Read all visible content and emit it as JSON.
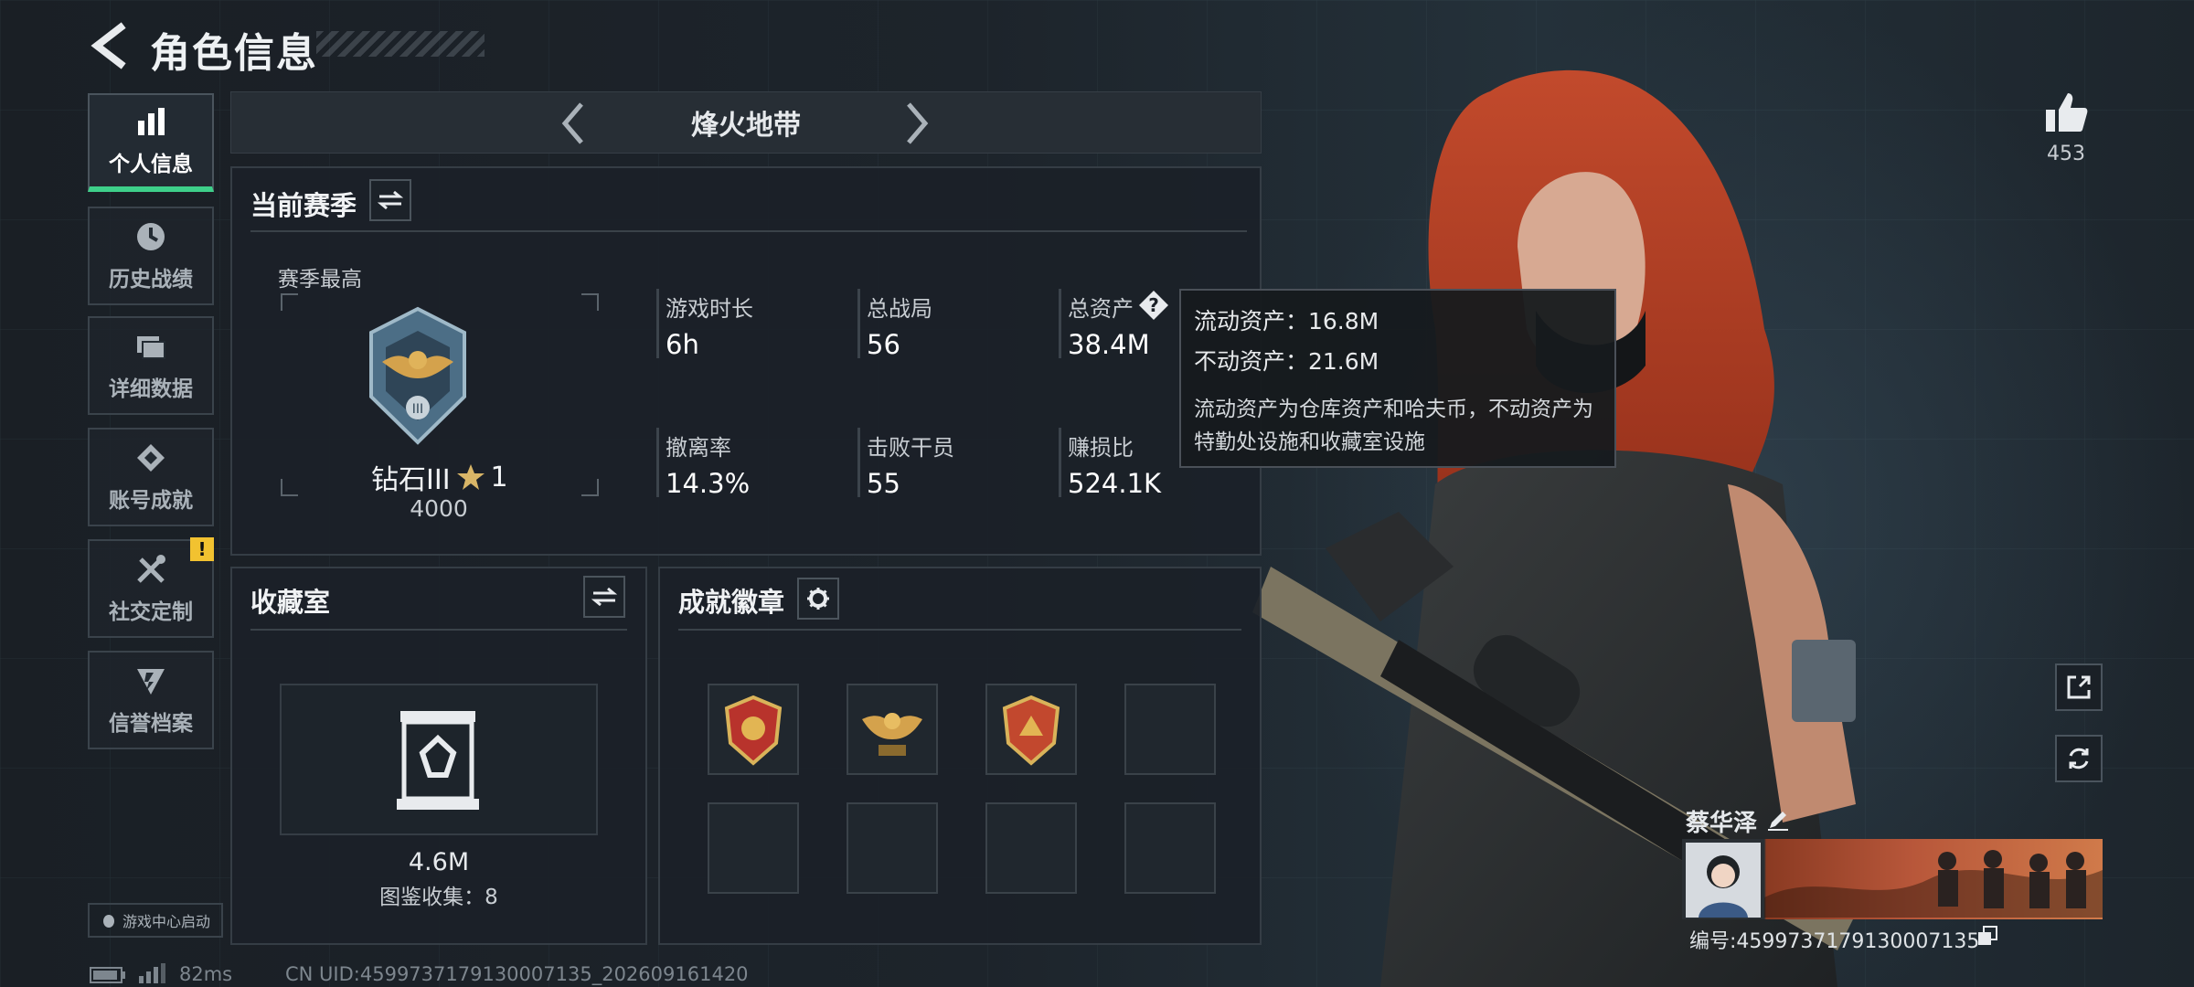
{
  "header": {
    "title": "角色信息"
  },
  "sidebar": {
    "items": [
      {
        "label": "个人信息"
      },
      {
        "label": "历史战绩"
      },
      {
        "label": "详细数据"
      },
      {
        "label": "账号成就"
      },
      {
        "label": "社交定制"
      },
      {
        "label": "信誉档案"
      }
    ],
    "alert_badge": "!",
    "game_center": "游戏中心启动"
  },
  "mode": {
    "name": "烽火地带"
  },
  "season": {
    "title": "当前赛季",
    "best_label": "赛季最高",
    "rank_name": "钻石III",
    "rank_stars": "1",
    "rank_score": "4000",
    "stats": [
      {
        "label": "游戏时长",
        "value": "6h"
      },
      {
        "label": "总战局",
        "value": "56"
      },
      {
        "label": "总资产",
        "value": "38.4M"
      },
      {
        "label": "撤离率",
        "value": "14.3%"
      },
      {
        "label": "击败干员",
        "value": "55"
      },
      {
        "label": "赚损比",
        "value": "524.1K"
      }
    ]
  },
  "tooltip": {
    "liquid": "流动资产：16.8M",
    "fixed": "不动资产：21.6M",
    "desc": "流动资产为仓库资产和哈夫币，不动资产为特勤处设施和收藏室设施"
  },
  "collection": {
    "title": "收藏室",
    "value": "4.6M",
    "catalog": "图鉴收集：8"
  },
  "achievements": {
    "title": "成就徽章"
  },
  "likes": {
    "count": "453"
  },
  "player": {
    "name": "蔡华泽",
    "id": "编号:4599737179130007135"
  },
  "footer": {
    "ping": "82ms",
    "uid": "CN UID:4599737179130007135_202609161420"
  },
  "colors": {
    "accent": "#3ed08a",
    "hair": "#b8432a",
    "badge": "#f2c230"
  }
}
